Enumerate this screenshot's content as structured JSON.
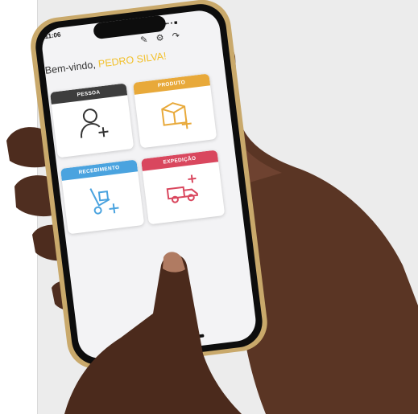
{
  "status": {
    "time": "11:06",
    "indicators": "•• • ■"
  },
  "toolbar": {
    "edit_icon": "✎",
    "settings_icon": "⚙",
    "logout_icon": "↷"
  },
  "welcome": {
    "greeting": "Bem-vindo, ",
    "user_name": "PEDRO SILVA!"
  },
  "cards": [
    {
      "label": "PESSOA",
      "color": "#3d3d3d",
      "icon": "person-add-icon"
    },
    {
      "label": "PRODUTO",
      "color": "#e8a93a",
      "icon": "box-add-icon"
    },
    {
      "label": "RECEBIMENTO",
      "color": "#4aa3df",
      "icon": "hand-truck-add-icon"
    },
    {
      "label": "EXPEDIÇÃO",
      "color": "#d9475e",
      "icon": "truck-add-icon"
    }
  ],
  "colors": {
    "accent_yellow": "#f2c12e",
    "background": "#ececec"
  }
}
